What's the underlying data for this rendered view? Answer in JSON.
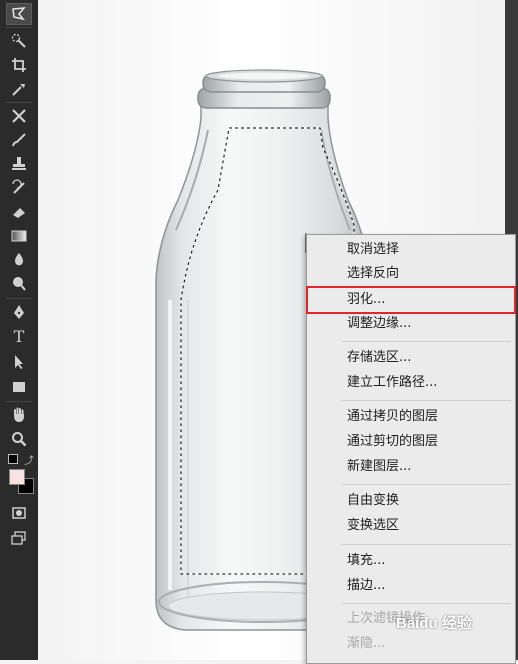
{
  "toolbar": {
    "tools": [
      {
        "name": "polygonal-lasso-icon",
        "active": true
      },
      {
        "name": "quick-selection-icon"
      },
      {
        "name": "crop-icon"
      },
      {
        "name": "eyedropper-icon"
      },
      {
        "name": "healing-brush-icon"
      },
      {
        "name": "brush-icon"
      },
      {
        "name": "clone-stamp-icon"
      },
      {
        "name": "history-brush-icon"
      },
      {
        "name": "eraser-icon"
      },
      {
        "name": "gradient-icon"
      },
      {
        "name": "blur-icon"
      },
      {
        "name": "dodge-icon"
      },
      {
        "name": "pen-icon"
      },
      {
        "name": "type-icon",
        "label": "T"
      },
      {
        "name": "path-selection-icon"
      },
      {
        "name": "rectangle-shape-icon"
      },
      {
        "name": "hand-icon"
      },
      {
        "name": "zoom-icon"
      }
    ],
    "foreground_color": "#f7e3e1",
    "background_color": "#000000"
  },
  "context_menu": {
    "items": [
      {
        "label": "取消选择"
      },
      {
        "label": "选择反向"
      },
      {
        "label": "羽化..."
      },
      {
        "label": "调整边缘..."
      },
      {
        "label": "存储选区..."
      },
      {
        "label": "建立工作路径..."
      },
      {
        "label": "通过拷贝的图层"
      },
      {
        "label": "通过剪切的图层"
      },
      {
        "label": "新建图层..."
      },
      {
        "label": "自由变换"
      },
      {
        "label": "变换选区"
      },
      {
        "label": "填充..."
      },
      {
        "label": "描边..."
      },
      {
        "label": "上次滤镜操作",
        "disabled": true
      },
      {
        "label": "渐隐...",
        "disabled": true
      }
    ],
    "highlighted_item": "羽化...",
    "highlight_color": "#e0252b"
  },
  "watermark": {
    "text": "Baidu 经验"
  }
}
